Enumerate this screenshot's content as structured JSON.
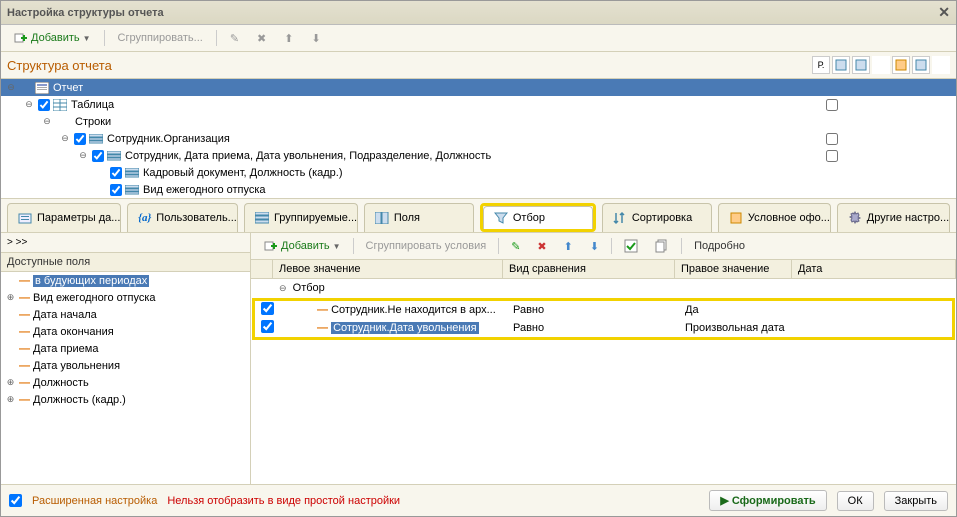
{
  "window": {
    "title": "Настройка структуры отчета"
  },
  "toolbar_top": {
    "add": "Добавить",
    "group": "Сгруппировать..."
  },
  "structure": {
    "title": "Структура отчета",
    "col_r": "Р.",
    "rows": [
      {
        "level": 0,
        "exp": "⊖",
        "chk": false,
        "icon": "report",
        "label": "Отчет",
        "sel": true,
        "rchk": false
      },
      {
        "level": 1,
        "exp": "⊖",
        "chk": true,
        "icon": "table",
        "label": "Таблица",
        "rchk": true
      },
      {
        "level": 2,
        "exp": "⊖",
        "chk": false,
        "icon": "",
        "label": "Строки",
        "rchk": false
      },
      {
        "level": 3,
        "exp": "⊖",
        "chk": true,
        "icon": "group",
        "label": "Сотрудник.Организация",
        "rchk": true
      },
      {
        "level": 4,
        "exp": "⊖",
        "chk": true,
        "icon": "group",
        "label": "Сотрудник, Дата приема, Дата увольнения, Подразделение, Должность",
        "rchk": true
      },
      {
        "level": 5,
        "exp": "",
        "chk": true,
        "icon": "group",
        "label": "Кадровый документ, Должность (кадр.)",
        "rchk": false
      },
      {
        "level": 5,
        "exp": "",
        "chk": true,
        "icon": "group",
        "label": "Вид ежегодного отпуска",
        "rchk": false
      }
    ]
  },
  "tabs": [
    {
      "id": "params",
      "label": "Параметры да...",
      "icon": "params"
    },
    {
      "id": "user",
      "label": "Пользователь...",
      "icon": "user"
    },
    {
      "id": "grouped",
      "label": "Группируемые...",
      "icon": "grouped"
    },
    {
      "id": "fields",
      "label": "Поля",
      "icon": "fields"
    },
    {
      "id": "filter",
      "label": "Отбор",
      "icon": "filter",
      "active": true
    },
    {
      "id": "sort",
      "label": "Сортировка",
      "icon": "sort"
    },
    {
      "id": "cond",
      "label": "Условное офо...",
      "icon": "cond"
    },
    {
      "id": "other",
      "label": "Другие настро...",
      "icon": "other"
    }
  ],
  "breadcrumb": "> >>",
  "available": {
    "title": "Доступные поля",
    "items": [
      {
        "exp": "",
        "label": "в будующих периодах",
        "sel": true
      },
      {
        "exp": "⊕",
        "label": "Вид ежегодного отпуска"
      },
      {
        "exp": "",
        "label": "Дата начала"
      },
      {
        "exp": "",
        "label": "Дата окончания"
      },
      {
        "exp": "",
        "label": "Дата приема"
      },
      {
        "exp": "",
        "label": "Дата увольнения"
      },
      {
        "exp": "⊕",
        "label": "Должность"
      },
      {
        "exp": "⊕",
        "label": "Должность (кадр.)"
      }
    ]
  },
  "filter_tb": {
    "add": "Добавить",
    "group": "Сгруппировать условия",
    "detail": "Подробно"
  },
  "filter_grid": {
    "cols": {
      "left": "Левое значение",
      "cmp": "Вид сравнения",
      "right": "Правое значение",
      "date": "Дата"
    },
    "group_label": "Отбор",
    "rows": [
      {
        "chk": true,
        "left": "Сотрудник.Не находится в арх...",
        "cmp": "Равно",
        "right": "Да",
        "sel": false
      },
      {
        "chk": true,
        "left": "Сотрудник.Дата увольнения",
        "cmp": "Равно",
        "right": "Произвольная дата",
        "sel": true
      }
    ]
  },
  "footer": {
    "adv": "Расширенная настройка",
    "warn": "Нельзя отобразить в виде простой настройки",
    "run": "Сформировать",
    "ok": "ОК",
    "close": "Закрыть"
  }
}
